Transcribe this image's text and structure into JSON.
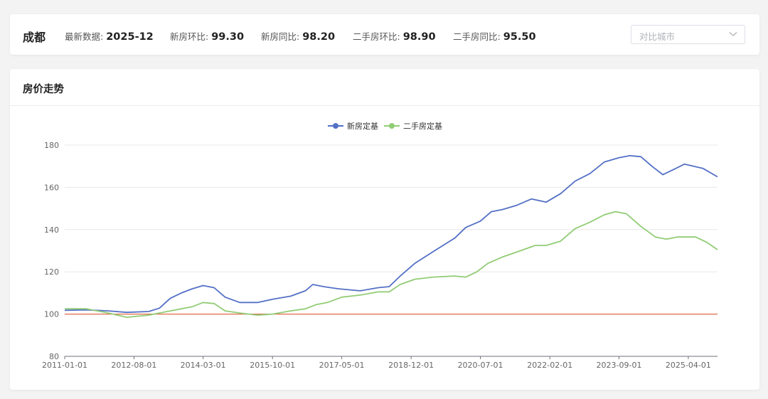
{
  "header": {
    "city": "成都",
    "metrics": [
      {
        "label": "最新数据:",
        "value": "2025-12"
      },
      {
        "label": "新房环比:",
        "value": "99.30"
      },
      {
        "label": "新房同比:",
        "value": "98.20"
      },
      {
        "label": "二手房环比:",
        "value": "98.90"
      },
      {
        "label": "二手房同比:",
        "value": "95.50"
      }
    ],
    "compare_select": {
      "placeholder": "对比城市",
      "icon": "chevron-down-icon"
    }
  },
  "section": {
    "title": "房价走势"
  },
  "colors": {
    "new_home": "#5470c6",
    "second_hand": "#91cc75",
    "baseline": "#e06c4a"
  },
  "chart_data": {
    "type": "line",
    "title": "",
    "xlabel": "",
    "ylabel": "",
    "ylim": [
      80,
      180
    ],
    "yticks": [
      80,
      100,
      120,
      140,
      160,
      180
    ],
    "xlim": [
      "2011-01-01",
      "2025-12-01"
    ],
    "xticks": [
      "2011-01-01",
      "2012-08-01",
      "2014-03-01",
      "2015-10-01",
      "2017-05-01",
      "2018-12-01",
      "2020-07-01",
      "2022-02-01",
      "2023-09-01",
      "2025-04-01"
    ],
    "grid": true,
    "legend_position": "top-center",
    "baseline": 100,
    "series": [
      {
        "name": "新房定基",
        "color": "#5470c6",
        "points": [
          [
            "2011-01-01",
            101.8
          ],
          [
            "2011-07-01",
            102.0
          ],
          [
            "2012-01-01",
            101.5
          ],
          [
            "2012-06-01",
            100.8
          ],
          [
            "2012-12-01",
            101.2
          ],
          [
            "2013-03-01",
            102.8
          ],
          [
            "2013-06-01",
            107.5
          ],
          [
            "2013-09-01",
            110.0
          ],
          [
            "2013-12-01",
            112.0
          ],
          [
            "2014-03-01",
            113.5
          ],
          [
            "2014-06-01",
            112.5
          ],
          [
            "2014-09-01",
            108.0
          ],
          [
            "2015-01-01",
            105.5
          ],
          [
            "2015-06-01",
            105.5
          ],
          [
            "2015-10-01",
            107.0
          ],
          [
            "2016-03-01",
            108.5
          ],
          [
            "2016-07-01",
            111.0
          ],
          [
            "2016-09-01",
            114.0
          ],
          [
            "2016-12-01",
            113.0
          ],
          [
            "2017-04-01",
            112.0
          ],
          [
            "2017-10-01",
            111.0
          ],
          [
            "2018-03-01",
            112.5
          ],
          [
            "2018-06-01",
            113.0
          ],
          [
            "2018-09-01",
            118.0
          ],
          [
            "2019-01-01",
            124.0
          ],
          [
            "2019-06-01",
            129.5
          ],
          [
            "2019-12-01",
            136.0
          ],
          [
            "2020-03-01",
            141.0
          ],
          [
            "2020-07-01",
            144.0
          ],
          [
            "2020-10-01",
            148.5
          ],
          [
            "2021-01-01",
            149.5
          ],
          [
            "2021-05-01",
            151.5
          ],
          [
            "2021-09-01",
            154.5
          ],
          [
            "2022-01-01",
            153.0
          ],
          [
            "2022-05-01",
            157.0
          ],
          [
            "2022-09-01",
            163.0
          ],
          [
            "2023-01-01",
            166.5
          ],
          [
            "2023-05-01",
            172.0
          ],
          [
            "2023-09-01",
            174.0
          ],
          [
            "2023-12-01",
            175.0
          ],
          [
            "2024-03-01",
            174.5
          ],
          [
            "2024-06-01",
            170.0
          ],
          [
            "2024-09-01",
            166.0
          ],
          [
            "2024-12-01",
            168.5
          ],
          [
            "2025-03-01",
            171.0
          ],
          [
            "2025-08-01",
            169.0
          ],
          [
            "2025-12-01",
            165.0
          ]
        ]
      },
      {
        "name": "二手房定基",
        "color": "#91cc75",
        "points": [
          [
            "2011-01-01",
            102.5
          ],
          [
            "2011-07-01",
            102.5
          ],
          [
            "2012-01-01",
            100.5
          ],
          [
            "2012-06-01",
            98.5
          ],
          [
            "2012-12-01",
            99.5
          ],
          [
            "2013-03-01",
            100.5
          ],
          [
            "2013-06-01",
            101.5
          ],
          [
            "2013-12-01",
            103.5
          ],
          [
            "2014-03-01",
            105.5
          ],
          [
            "2014-06-01",
            105.0
          ],
          [
            "2014-09-01",
            101.5
          ],
          [
            "2015-01-01",
            100.5
          ],
          [
            "2015-06-01",
            99.5
          ],
          [
            "2015-10-01",
            100.0
          ],
          [
            "2016-03-01",
            101.5
          ],
          [
            "2016-07-01",
            102.5
          ],
          [
            "2016-10-01",
            104.5
          ],
          [
            "2017-01-01",
            105.5
          ],
          [
            "2017-05-01",
            108.0
          ],
          [
            "2017-10-01",
            109.0
          ],
          [
            "2018-03-01",
            110.5
          ],
          [
            "2018-06-01",
            110.5
          ],
          [
            "2018-09-01",
            114.0
          ],
          [
            "2019-01-01",
            116.5
          ],
          [
            "2019-06-01",
            117.5
          ],
          [
            "2019-12-01",
            118.0
          ],
          [
            "2020-03-01",
            117.5
          ],
          [
            "2020-06-01",
            120.0
          ],
          [
            "2020-09-01",
            124.0
          ],
          [
            "2021-01-01",
            127.0
          ],
          [
            "2021-06-01",
            130.0
          ],
          [
            "2021-10-01",
            132.5
          ],
          [
            "2022-01-01",
            132.5
          ],
          [
            "2022-05-01",
            134.5
          ],
          [
            "2022-09-01",
            140.5
          ],
          [
            "2023-01-01",
            143.5
          ],
          [
            "2023-05-01",
            147.0
          ],
          [
            "2023-08-01",
            148.5
          ],
          [
            "2023-11-01",
            147.5
          ],
          [
            "2024-03-01",
            141.5
          ],
          [
            "2024-07-01",
            136.5
          ],
          [
            "2024-10-01",
            135.5
          ],
          [
            "2025-01-01",
            136.5
          ],
          [
            "2025-06-01",
            136.5
          ],
          [
            "2025-09-01",
            134.0
          ],
          [
            "2025-12-01",
            130.5
          ]
        ]
      }
    ]
  }
}
